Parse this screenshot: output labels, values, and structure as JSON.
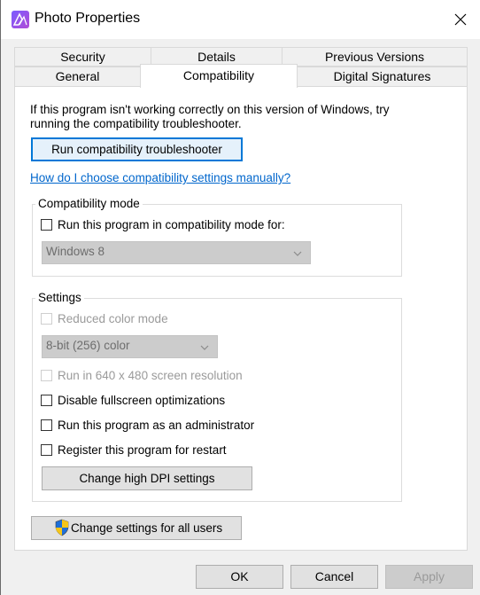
{
  "window": {
    "title": "Photo Properties"
  },
  "tabs": {
    "row1": [
      "Security",
      "Details",
      "Previous Versions"
    ],
    "row2": [
      "General",
      "Compatibility",
      "Digital Signatures"
    ],
    "active": "Compatibility"
  },
  "compat": {
    "intro": "If this program isn't working correctly on this version of Windows, try running the compatibility troubleshooter.",
    "troubleshooter_button": "Run compatibility troubleshooter",
    "help_link": "How do I choose compatibility settings manually?",
    "mode_group": {
      "label": "Compatibility mode",
      "checkbox_label": "Run this program in compatibility mode for:",
      "selected_os": "Windows 8"
    },
    "settings_group": {
      "label": "Settings",
      "reduced_color": "Reduced color mode",
      "color_select": "8-bit (256) color",
      "resolution": "Run in 640 x 480 screen resolution",
      "disable_fullscreen": "Disable fullscreen optimizations",
      "run_admin": "Run this program as an administrator",
      "register_restart": "Register this program for restart",
      "high_dpi_button": "Change high DPI settings"
    },
    "all_users_button": "Change settings for all users"
  },
  "footer": {
    "ok": "OK",
    "cancel": "Cancel",
    "apply": "Apply"
  },
  "colors": {
    "accent": "#0078d7",
    "link": "#0066cc"
  }
}
